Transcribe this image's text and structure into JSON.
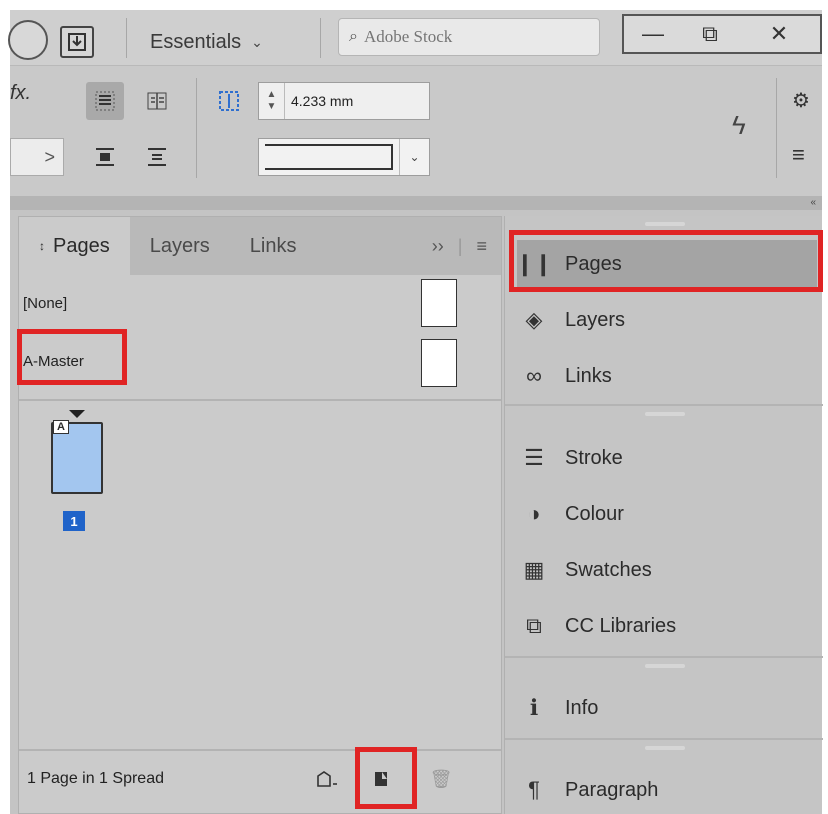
{
  "titlebar": {
    "workspace_label": "Essentials",
    "stock_placeholder": "Adobe Stock",
    "minimize_glyph": "—",
    "restore_glyph": "⧉",
    "close_glyph": "✕"
  },
  "controlbar": {
    "fx_label": "fx.",
    "gap_value": "4.233 mm"
  },
  "pages_panel": {
    "tabs": [
      {
        "label": "Pages",
        "active": true
      },
      {
        "label": "Layers",
        "active": false
      },
      {
        "label": "Links",
        "active": false
      }
    ],
    "overflow_glyph": "››",
    "masters": [
      {
        "label": "[None]"
      },
      {
        "label": "A-Master"
      }
    ],
    "page_prefix": "A",
    "page_number": "1",
    "footer_text": "1 Page in 1 Spread"
  },
  "dock": {
    "groups": [
      [
        {
          "label": "Pages",
          "icon": "pages-icon",
          "active": true
        },
        {
          "label": "Layers",
          "icon": "layers-icon"
        },
        {
          "label": "Links",
          "icon": "links-icon"
        }
      ],
      [
        {
          "label": "Stroke",
          "icon": "stroke-icon"
        },
        {
          "label": "Colour",
          "icon": "colour-icon"
        },
        {
          "label": "Swatches",
          "icon": "swatches-icon"
        },
        {
          "label": "CC Libraries",
          "icon": "cc-libraries-icon"
        }
      ],
      [
        {
          "label": "Info",
          "icon": "info-icon"
        }
      ],
      [
        {
          "label": "Paragraph",
          "icon": "paragraph-icon"
        }
      ]
    ]
  },
  "colors": {
    "highlight": "#e02424",
    "page_number_bg": "#1f63c9",
    "page_thumb": "#a3c6ef"
  }
}
